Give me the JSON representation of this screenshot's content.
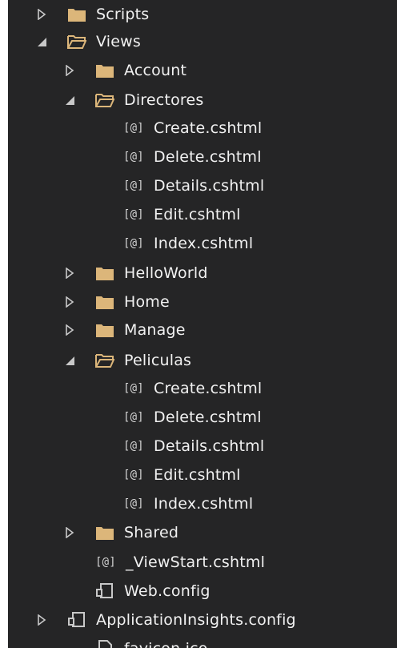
{
  "tree": {
    "items": [
      {
        "label": "Scripts",
        "type": "folder",
        "expanded": false,
        "level": 1
      },
      {
        "label": "Views",
        "type": "folder",
        "expanded": true,
        "level": 1
      },
      {
        "label": "Account",
        "type": "folder",
        "expanded": false,
        "level": 2
      },
      {
        "label": "Directores",
        "type": "folder",
        "expanded": true,
        "level": 2
      },
      {
        "label": "Create.cshtml",
        "type": "cshtml",
        "level": 3
      },
      {
        "label": "Delete.cshtml",
        "type": "cshtml",
        "level": 3
      },
      {
        "label": "Details.cshtml",
        "type": "cshtml",
        "level": 3
      },
      {
        "label": "Edit.cshtml",
        "type": "cshtml",
        "level": 3
      },
      {
        "label": "Index.cshtml",
        "type": "cshtml",
        "level": 3
      },
      {
        "label": "HelloWorld",
        "type": "folder",
        "expanded": false,
        "level": 2
      },
      {
        "label": "Home",
        "type": "folder",
        "expanded": false,
        "level": 2
      },
      {
        "label": "Manage",
        "type": "folder",
        "expanded": false,
        "level": 2
      },
      {
        "label": "Peliculas",
        "type": "folder",
        "expanded": true,
        "level": 2
      },
      {
        "label": "Create.cshtml",
        "type": "cshtml",
        "level": 3
      },
      {
        "label": "Delete.cshtml",
        "type": "cshtml",
        "level": 3
      },
      {
        "label": "Details.cshtml",
        "type": "cshtml",
        "level": 3
      },
      {
        "label": "Edit.cshtml",
        "type": "cshtml",
        "level": 3
      },
      {
        "label": "Index.cshtml",
        "type": "cshtml",
        "level": 3
      },
      {
        "label": "Shared",
        "type": "folder",
        "expanded": false,
        "level": 2
      },
      {
        "label": "_ViewStart.cshtml",
        "type": "cshtml",
        "level": 2
      },
      {
        "label": "Web.config",
        "type": "config",
        "level": 2
      },
      {
        "label": "ApplicationInsights.config",
        "type": "config",
        "expanded": false,
        "level": 1
      },
      {
        "label": "favicon.ico",
        "type": "file",
        "level": 2
      }
    ],
    "cshtml_icon_text": "[@]",
    "colors": {
      "background": "#252526",
      "text": "#f1f1f1",
      "folder": "#dcb67a",
      "arrow": "#c8c8c8"
    },
    "icons": {
      "collapsed": "triangle-right-icon",
      "expanded": "triangle-down-icon",
      "folder_closed": "folder-icon",
      "folder_open": "folder-open-icon",
      "config": "config-file-icon",
      "cshtml": "cshtml-file-icon",
      "file": "file-icon"
    }
  }
}
